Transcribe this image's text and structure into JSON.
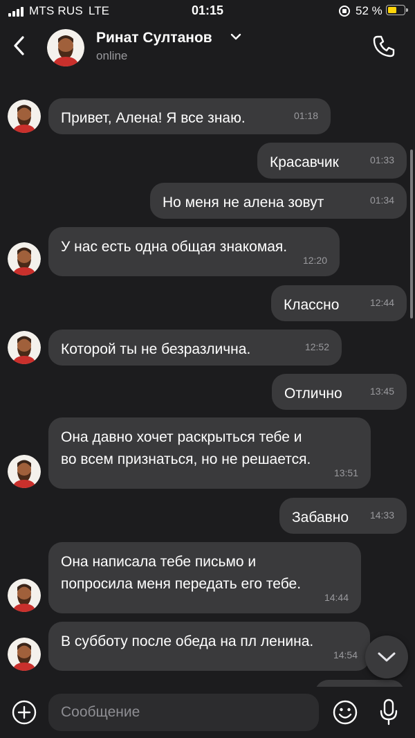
{
  "status_bar": {
    "carrier": "MTS RUS",
    "network": "LTE",
    "time": "01:15",
    "battery_percent": "52 %",
    "battery_level": 0.52,
    "battery_color": "#ffd60a"
  },
  "header": {
    "contact_name": "Ринат Султанов",
    "status": "online",
    "back_icon": "chevron-left-icon",
    "call_icon": "phone-icon"
  },
  "messages": [
    {
      "from": "contact",
      "text": "Привет, Алена! Я все знаю.",
      "time": "01:18"
    },
    {
      "from": "me",
      "text": "Красавчик",
      "time": "01:33"
    },
    {
      "from": "me",
      "text": "Но меня не алена зовут",
      "time": "01:34"
    },
    {
      "from": "contact",
      "text": "У нас есть одна общая знакомая.",
      "time": "12:20"
    },
    {
      "from": "me",
      "text": "Классно",
      "time": "12:44"
    },
    {
      "from": "contact",
      "text": "Которой ты не безразлична.",
      "time": "12:52"
    },
    {
      "from": "me",
      "text": "Отлично",
      "time": "13:45"
    },
    {
      "from": "contact",
      "lines": [
        "Она давно хочет раскрыться тебе и",
        "во всем признаться, но не решается."
      ],
      "time": "13:51"
    },
    {
      "from": "me",
      "text": "Забавно",
      "time": "14:33"
    },
    {
      "from": "contact",
      "lines": [
        "Она написала тебе письмо и",
        "попросила меня передать его тебе."
      ],
      "time": "14:44"
    },
    {
      "from": "contact",
      "text": "В субботу после обеда на пл ленина.",
      "time": "14:54"
    }
  ],
  "composer": {
    "placeholder": "Сообщение",
    "bubble_color": "#3a3a3c"
  }
}
